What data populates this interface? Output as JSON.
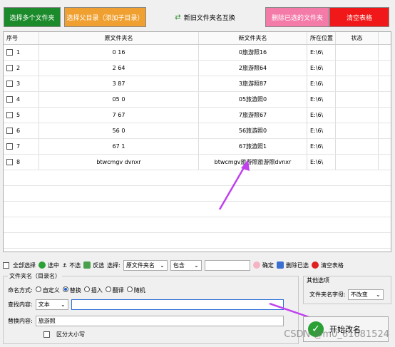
{
  "toolbar": {
    "select_multi": "选择多个文件夹",
    "select_parent": "选择父目录（添加子目录）",
    "swap": "新旧文件夹名互换",
    "delete_selected": "删除已选的文件夹",
    "clear": "清空表格"
  },
  "table": {
    "headers": [
      "序号",
      "原文件夹名",
      "新文件夹名",
      "所在位置",
      "状态"
    ],
    "rows": [
      {
        "num": "1",
        "orig": "0 16",
        "new": "0旅游照16",
        "loc": "E:\\6\\",
        "status": ""
      },
      {
        "num": "2",
        "orig": "2 64",
        "new": "2旅游照64",
        "loc": "E:\\6\\",
        "status": ""
      },
      {
        "num": "3",
        "orig": "3 87",
        "new": "3旅游照87",
        "loc": "E:\\6\\",
        "status": ""
      },
      {
        "num": "4",
        "orig": "05 0",
        "new": "05旅游照0",
        "loc": "E:\\6\\",
        "status": ""
      },
      {
        "num": "5",
        "orig": "7 67",
        "new": "7旅游照67",
        "loc": "E:\\6\\",
        "status": ""
      },
      {
        "num": "6",
        "orig": "56 0",
        "new": "56旅游照0",
        "loc": "E:\\6\\",
        "status": ""
      },
      {
        "num": "7",
        "orig": "67 1",
        "new": "67旅游照1",
        "loc": "E:\\6\\",
        "status": ""
      },
      {
        "num": "8",
        "orig": "btwcmgv  dvnxr",
        "new": "btwcmgv旅游照旅游照dvnxr",
        "loc": "E:\\6\\",
        "status": ""
      }
    ]
  },
  "selbar": {
    "select_all": "全部选择",
    "select": "选中",
    "unselect": "不选",
    "invert": "反选",
    "choose_label": "选择:",
    "choose_value": "原文件夹名",
    "match_value": "包含",
    "match_input": "",
    "confirm": "确定",
    "delete_selected": "删除已选",
    "clear_table": "清空表格"
  },
  "panel": {
    "title": "文件夹名（目录名）",
    "naming_label": "命名方式:",
    "naming_options": [
      "自定义",
      "替换",
      "插入",
      "翻译",
      "随机"
    ],
    "naming_selected": "替换",
    "find_label": "查找内容:",
    "find_type": "文本",
    "find_value": "",
    "replace_label": "替换内容:",
    "replace_value": "旅游照",
    "case_label": "区分大小写"
  },
  "other": {
    "title": "其他选项",
    "case_label": "文件夹名字母:",
    "case_value": "不改变"
  },
  "start_button": "开始改名",
  "watermark": "CSDN @m0_61681524"
}
